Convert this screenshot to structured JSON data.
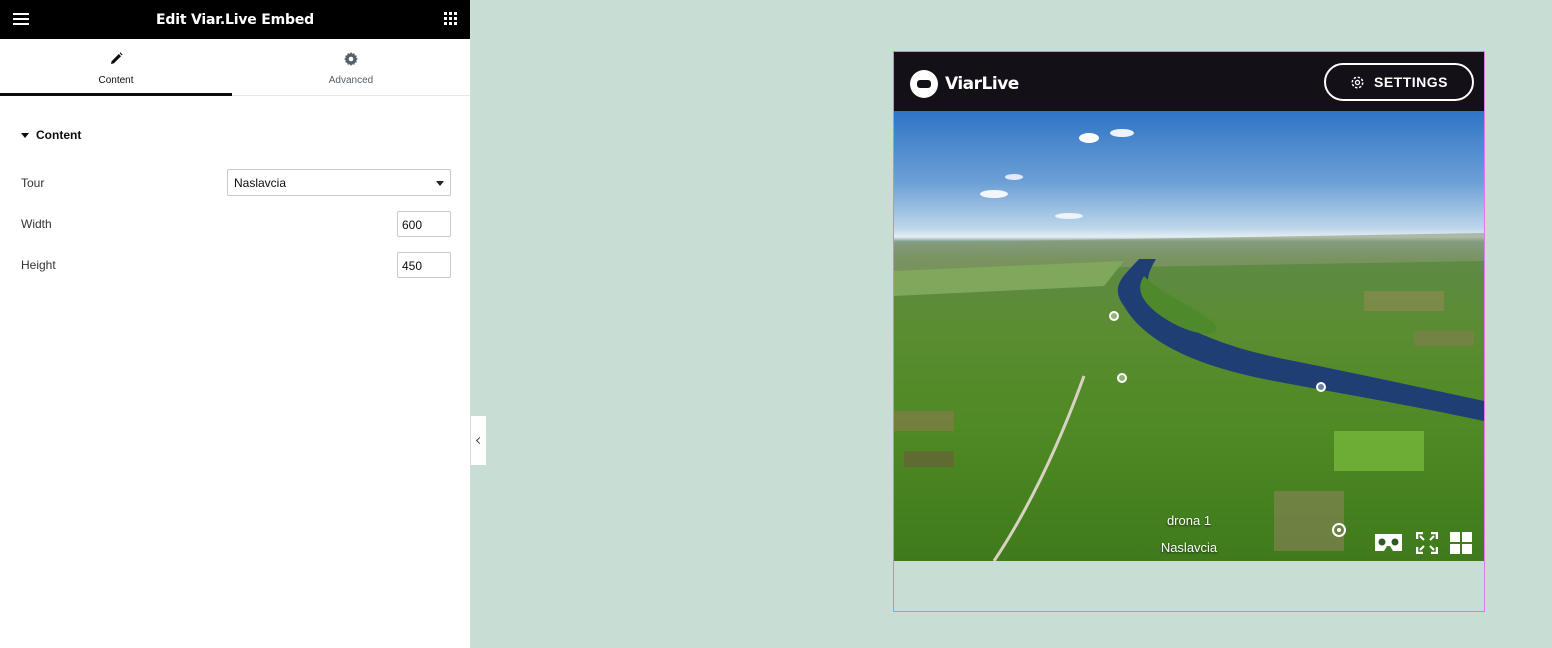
{
  "panel": {
    "title": "Edit Viar.Live Embed",
    "tabs": [
      {
        "label": "Content",
        "icon": "pencil-icon",
        "active": true
      },
      {
        "label": "Advanced",
        "icon": "gear-icon",
        "active": false
      }
    ],
    "section": "Content",
    "controls": {
      "tour": {
        "label": "Tour",
        "value": "Naslavcia"
      },
      "width": {
        "label": "Width",
        "value": "600"
      },
      "height": {
        "label": "Height",
        "value": "450"
      }
    }
  },
  "widget": {
    "brand": "ViarLive",
    "settings_label": "SETTINGS",
    "scene_name": "drona 1",
    "tour_name": "Naslavcia",
    "icons": [
      "vr-headset-icon",
      "fullscreen-icon",
      "scenes-grid-icon",
      "target-icon"
    ]
  },
  "colors": {
    "background": "#c8ded4",
    "topbar": "#000000",
    "selection_border": "#e077ee",
    "viewer_header": "#141018"
  }
}
